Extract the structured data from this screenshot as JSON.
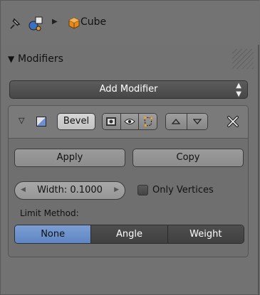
{
  "breadcrumb": {
    "object": "Cube"
  },
  "panel": {
    "title": "Modifiers"
  },
  "add_modifier": {
    "label": "Add Modifier"
  },
  "modifier": {
    "name": "Bevel",
    "apply_label": "Apply",
    "copy_label": "Copy",
    "width_value": "Width: 0.1000",
    "only_vertices_label": "Only Vertices",
    "only_vertices_checked": false,
    "limit_method_label": "Limit Method:",
    "limit_methods": [
      "None",
      "Angle",
      "Weight"
    ],
    "limit_method_selected": "None"
  },
  "colors": {
    "accent": "#6a8fcb",
    "panel_bg": "#727272"
  },
  "icons": [
    "pin-icon",
    "scene-icon",
    "cube-icon",
    "modifier-type-icon",
    "render-icon",
    "viewport-eye-icon",
    "editmode-icon",
    "move-up-icon",
    "move-down-icon",
    "close-icon"
  ]
}
